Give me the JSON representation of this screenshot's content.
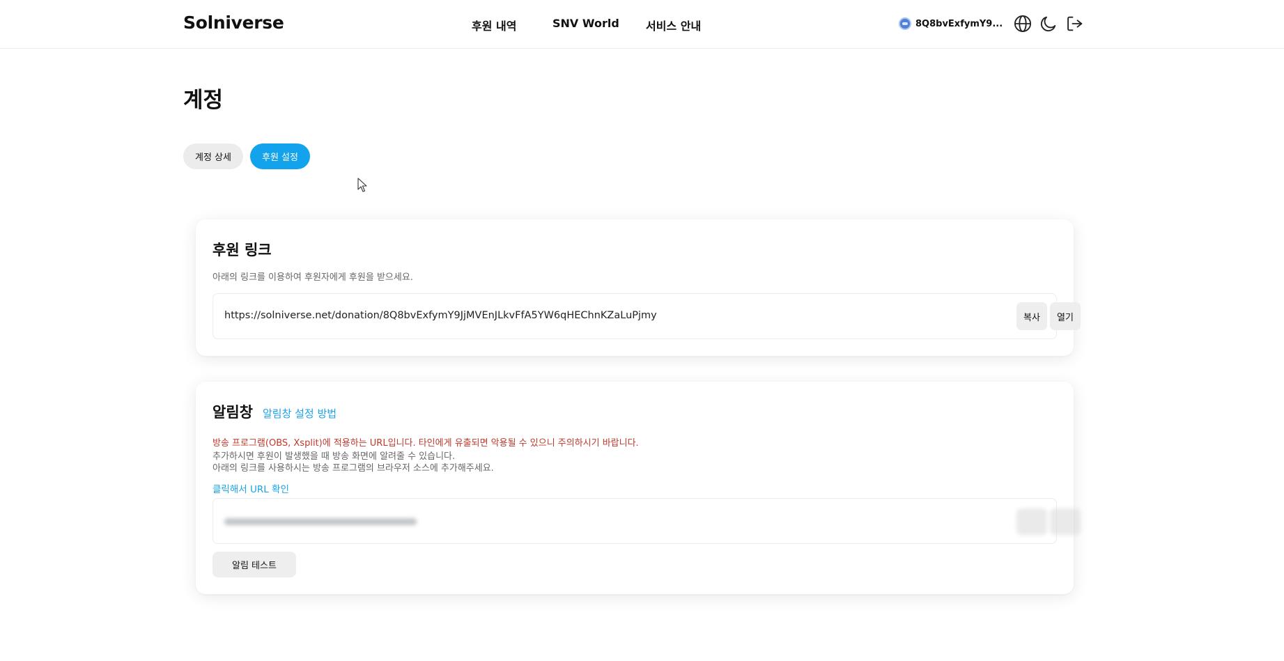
{
  "header": {
    "logo": "Solniverse",
    "nav": [
      {
        "label": "후원 내역"
      },
      {
        "label": "SNV World"
      },
      {
        "label": "서비스 안내"
      }
    ],
    "wallet_address": "8Q8bvExfymY9..."
  },
  "page": {
    "title": "계정",
    "tabs": [
      {
        "label": "계정 상세",
        "active": false
      },
      {
        "label": "후원 설정",
        "active": true
      }
    ]
  },
  "donation_link_card": {
    "title": "후원 링크",
    "description": "아래의 링크를 이용하여 후원자에게 후원을 받으세요.",
    "url": "https://solniverse.net/donation/8Q8bvExfymY9JjMVEnJLkvFfA5YW6qHEChnKZaLuPjmy",
    "copy_label": "복사",
    "open_label": "열기"
  },
  "alert_card": {
    "title": "알림창",
    "guide_link": "알림창 설정 방법",
    "warning": "방송 프로그램(OBS, Xsplit)에 적용하는 URL입니다. 타인에게 유출되면 악용될 수 있으니 주의하시기 바랍니다.",
    "desc_line1": "추가하시면 후원이 발생했을 때 방송 화면에 알려줄 수 있습니다.",
    "desc_line2": "아래의 링크를 사용하시는 방송 프로그램의 브라우저 소스에 추가해주세요.",
    "reveal_link": "클릭해서 URL 확인",
    "test_button": "알림 테스트"
  },
  "colors": {
    "accent": "#12a3ec",
    "link": "#1aa3e8",
    "warning": "#c0392b"
  }
}
